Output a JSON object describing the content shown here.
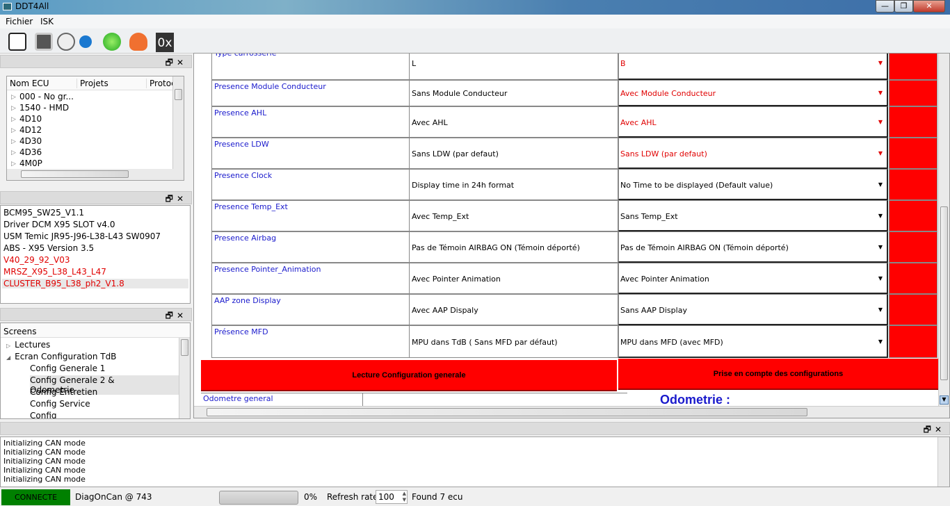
{
  "window": {
    "title": "DDT4All"
  },
  "menu": [
    "Fichier",
    "ISK"
  ],
  "toolbar": {
    "icons": [
      "qr-search-icon",
      "monitor-icon",
      "sniffer-icon",
      "refresh-small-icon",
      "refresh-green-icon",
      "heart-monitor-icon",
      "hex-icon"
    ],
    "hex_label": "0x"
  },
  "ecu_panel": {
    "columns": [
      "Nom ECU",
      "Projets",
      "Protoc"
    ],
    "items": [
      "000 - No gr...",
      "1540 - HMD",
      "4D10",
      "4D12",
      "4D30",
      "4D36",
      "4M0P"
    ]
  },
  "ecu_list": {
    "items": [
      {
        "label": "BCM95_SW25_V1.1",
        "color": "#000000"
      },
      {
        "label": "Driver DCM X95 SLOT v4.0",
        "color": "#000000"
      },
      {
        "label": "USM Temic JR95-J96-L38-L43 SW0907",
        "color": "#000000"
      },
      {
        "label": "ABS - X95 Version 3.5",
        "color": "#000000"
      },
      {
        "label": "V40_29_92_V03",
        "color": "#e00000"
      },
      {
        "label": "MRSZ_X95_L38_L43_L47",
        "color": "#e00000"
      },
      {
        "label": "CLUSTER_B95_L38_ph2_V1.8",
        "color": "#e00000"
      }
    ]
  },
  "screens": {
    "header": "Screens",
    "items": [
      {
        "label": "Lectures",
        "level": 0,
        "expand": "▷"
      },
      {
        "label": "Ecran Configuration TdB",
        "level": 0,
        "expand": "◢"
      },
      {
        "label": "Config Generale 1",
        "level": 1
      },
      {
        "label": "Config Generale 2 & Odometrie",
        "level": 1,
        "selected": true
      },
      {
        "label": "Config Entretien",
        "level": 1
      },
      {
        "label": "Config Service",
        "level": 1
      },
      {
        "label": "Config",
        "level": 1
      }
    ]
  },
  "config_rows": [
    {
      "label": "Type carrosserie",
      "value": "L",
      "selected": "B",
      "mismatch": true
    },
    {
      "label": "Presence Module Conducteur",
      "value": "Sans Module Conducteur",
      "selected": "Avec Module Conducteur",
      "mismatch": true
    },
    {
      "label": "Presence AHL",
      "value": "Avec AHL",
      "selected": "Avec AHL",
      "mismatch": true
    },
    {
      "label": "Presence LDW",
      "value": "Sans LDW (par defaut)",
      "selected": "Sans LDW (par defaut)",
      "mismatch": true
    },
    {
      "label": "Presence Clock",
      "value": "Display time in 24h format",
      "selected": "No Time to be displayed (Default value)",
      "mismatch": false
    },
    {
      "label": "Presence Temp_Ext",
      "value": "Avec Temp_Ext",
      "selected": "Sans Temp_Ext",
      "mismatch": false
    },
    {
      "label": "Presence Airbag",
      "value": "Pas de Témoin AIRBAG ON (Témoin déporté)",
      "selected": "Pas de Témoin AIRBAG ON (Témoin déporté)",
      "mismatch": false
    },
    {
      "label": "Presence Pointer_Animation",
      "value": "Avec Pointer Animation",
      "selected": "Avec Pointer Animation",
      "mismatch": false
    },
    {
      "label": "AAP zone Display",
      "value": "Avec AAP Dispaly",
      "selected": "Sans AAP Display",
      "mismatch": false
    },
    {
      "label": "Présence MFD",
      "value": "MPU dans TdB ( Sans MFD  par défaut)",
      "selected": "MPU dans MFD (avec MFD)",
      "mismatch": false
    }
  ],
  "buttons": {
    "read": "Lecture Configuration generale",
    "apply": "Prise en compte des configurations"
  },
  "odometer": {
    "label": "Odometre general",
    "title": "Odometrie :"
  },
  "log": [
    "Initializing CAN mode",
    "Initializing CAN mode",
    "Initializing CAN mode",
    "Initializing CAN mode",
    "Initializing CAN mode"
  ],
  "status": {
    "connection": "CONNECTE",
    "connection_color": "#008000",
    "adapter": "DiagOnCan @ 743",
    "progress": 0,
    "progress_label": "0%",
    "refresh_label": "Refresh rate:",
    "refresh_value": "100",
    "found": "Found 7 ecu"
  }
}
